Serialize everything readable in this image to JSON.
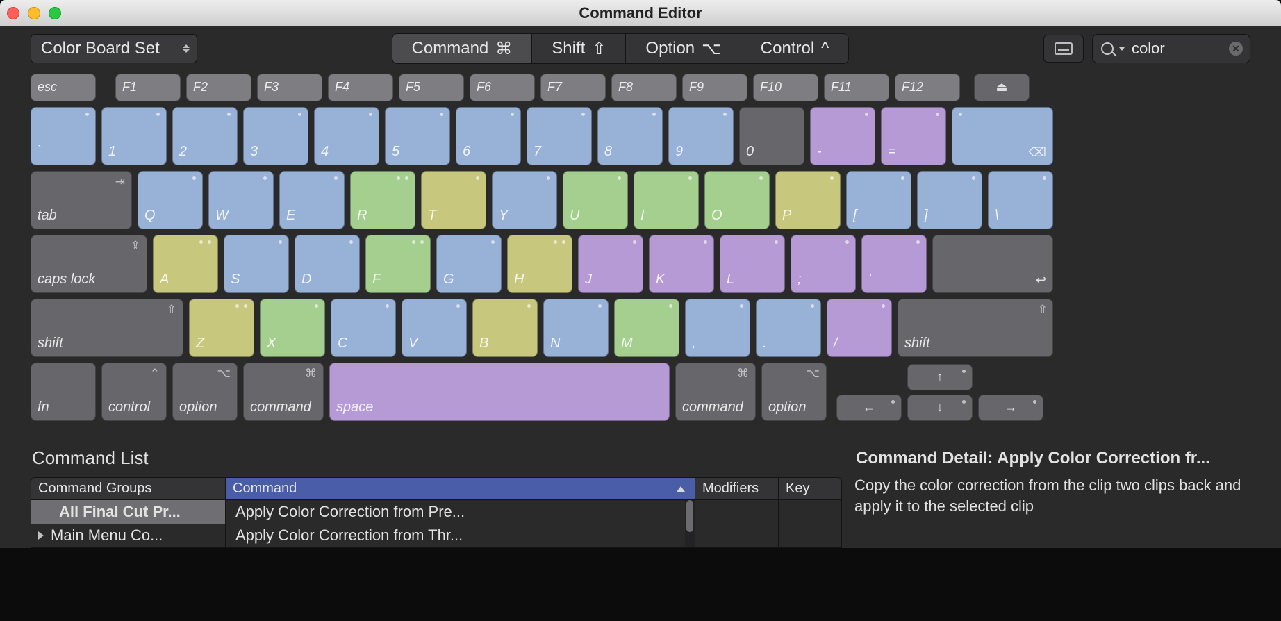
{
  "window_title": "Command Editor",
  "toolbar": {
    "preset_label": "Color Board Set",
    "modifiers": [
      {
        "label": "Command",
        "symbol": "⌘",
        "active": true
      },
      {
        "label": "Shift",
        "symbol": "⇧",
        "active": false
      },
      {
        "label": "Option",
        "symbol": "⌥",
        "active": false
      },
      {
        "label": "Control",
        "symbol": "^",
        "active": false
      }
    ],
    "search_value": "color"
  },
  "keyboard": {
    "fn_row": [
      "esc",
      "F1",
      "F2",
      "F3",
      "F4",
      "F5",
      "F6",
      "F7",
      "F8",
      "F9",
      "F10",
      "F11",
      "F12"
    ],
    "num_row": {
      "keys": [
        "`",
        "1",
        "2",
        "3",
        "4",
        "5",
        "6",
        "7",
        "8",
        "9",
        "0",
        "-",
        "=",
        "delete"
      ],
      "colors": [
        "blue",
        "blue",
        "blue",
        "blue",
        "blue",
        "blue",
        "blue",
        "blue",
        "blue",
        "blue",
        "dgrey",
        "purple",
        "purple",
        "blue"
      ]
    },
    "q_row": {
      "tab": "tab",
      "keys": [
        "Q",
        "W",
        "E",
        "R",
        "T",
        "Y",
        "U",
        "I",
        "O",
        "P",
        "[",
        "]",
        "\\"
      ],
      "colors": [
        "blue",
        "blue",
        "blue",
        "green",
        "olive",
        "blue",
        "green",
        "green",
        "green",
        "olive",
        "blue",
        "blue",
        "blue"
      ]
    },
    "a_row": {
      "caps": "caps lock",
      "keys": [
        "A",
        "S",
        "D",
        "F",
        "G",
        "H",
        "J",
        "K",
        "L",
        ";",
        "'"
      ],
      "colors": [
        "olive",
        "blue",
        "blue",
        "green",
        "blue",
        "olive",
        "purple",
        "purple",
        "purple",
        "purple",
        "purple"
      ],
      "return": "↩"
    },
    "z_row": {
      "lshift": "shift",
      "keys": [
        "Z",
        "X",
        "C",
        "V",
        "B",
        "N",
        "M",
        ",",
        ".",
        "/"
      ],
      "colors": [
        "olive",
        "green",
        "blue",
        "blue",
        "olive",
        "blue",
        "green",
        "blue",
        "blue",
        "purple"
      ],
      "rshift": "shift"
    },
    "bottom": {
      "fn": "fn",
      "control": "control",
      "loption": "option",
      "lcommand": "command",
      "space": "space",
      "rcommand": "command",
      "roption": "option"
    },
    "arrows": {
      "up": "↑",
      "left": "←",
      "down": "↓",
      "right": "→"
    }
  },
  "command_list": {
    "title": "Command List",
    "headers": {
      "groups": "Command Groups",
      "command": "Command",
      "modifiers": "Modifiers",
      "key": "Key"
    },
    "groups": [
      {
        "label": "All Final Cut Pr...",
        "selected": true
      },
      {
        "label": "Main Menu Co...",
        "selected": false,
        "expandable": true
      }
    ],
    "commands": [
      {
        "label": "Apply Color Correction from Pre...",
        "modifiers": "",
        "key": ""
      },
      {
        "label": "Apply Color Correction from Thr...",
        "modifiers": "",
        "key": ""
      }
    ]
  },
  "detail": {
    "title": "Command Detail: Apply Color Correction fr...",
    "body": "Copy the color correction from the clip two clips back and apply it to the selected clip"
  }
}
